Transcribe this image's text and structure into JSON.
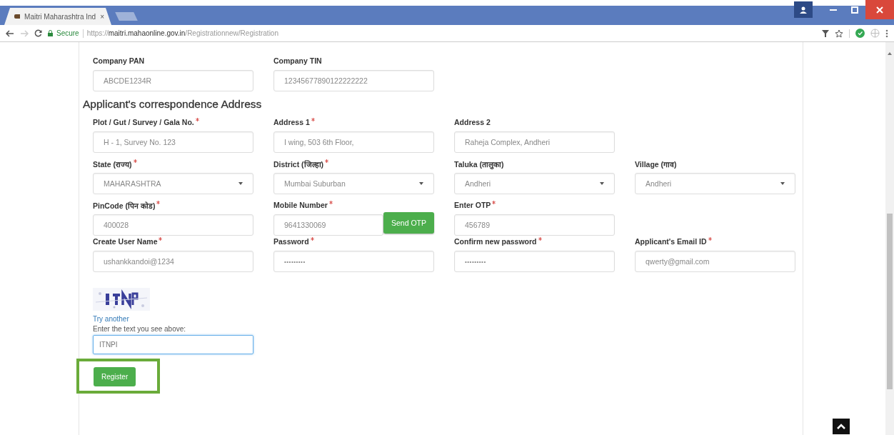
{
  "browser": {
    "tab": {
      "title": "Maitri Maharashtra Ind",
      "close": "×"
    },
    "address": {
      "secure": "Secure",
      "scheme": "https://",
      "host": "maitri.mahaonline.gov.in",
      "path": "/Registrationnew/Registration"
    }
  },
  "form": {
    "top_fields": [
      {
        "label": "Company PAN",
        "required": false,
        "kind": "text",
        "value": "ABCDE1234R"
      },
      {
        "label": "Company TIN",
        "required": false,
        "kind": "text",
        "value": "12345677890122222222"
      }
    ],
    "heading": "Applicant's correspondence Address",
    "rows": [
      [
        {
          "label": "Plot / Gut / Survey / Gala No.",
          "required": true,
          "kind": "text",
          "value": "H - 1, Survey No. 123"
        },
        {
          "label": "Address 1",
          "required": true,
          "kind": "text",
          "value": "I wing, 503 6th Floor,"
        },
        {
          "label": "Address 2",
          "required": false,
          "kind": "text",
          "value": "Raheja Complex, Andheri"
        }
      ],
      [
        {
          "label": "State (राज्य)",
          "required": true,
          "kind": "select",
          "value": "MAHARASHTRA"
        },
        {
          "label": "District (जिल्हा)",
          "required": true,
          "kind": "select",
          "value": "Mumbai Suburban"
        },
        {
          "label": "Taluka (तालुका)",
          "required": false,
          "kind": "select",
          "value": "Andheri"
        },
        {
          "label": "Village (गाव)",
          "required": false,
          "kind": "select",
          "value": "Andheri"
        }
      ],
      [
        {
          "label": "PinCode (पिन कोड)",
          "required": true,
          "kind": "text",
          "value": "400028"
        },
        {
          "label": "Mobile Number",
          "required": true,
          "kind": "text",
          "value": "9641330069",
          "button": "Send OTP"
        },
        {
          "label": "Enter OTP",
          "required": true,
          "kind": "text",
          "value": "456789"
        }
      ],
      [
        {
          "label": "Create User Name",
          "required": true,
          "kind": "text",
          "value": "ushankkandoi@1234"
        },
        {
          "label": "Password",
          "required": true,
          "kind": "password",
          "value": "•••••••••"
        },
        {
          "label": "Confirm new password",
          "required": true,
          "kind": "password",
          "value": "•••••••••"
        },
        {
          "label": "Applicant's Email ID",
          "required": true,
          "kind": "text",
          "value": "qwerty@gmail.com"
        }
      ]
    ],
    "captcha": {
      "link": "Try another",
      "label": "Enter the text you see above:",
      "value": "ITNPI",
      "focused": true
    },
    "register_button": {
      "label": "Register",
      "highlighted": true
    }
  }
}
